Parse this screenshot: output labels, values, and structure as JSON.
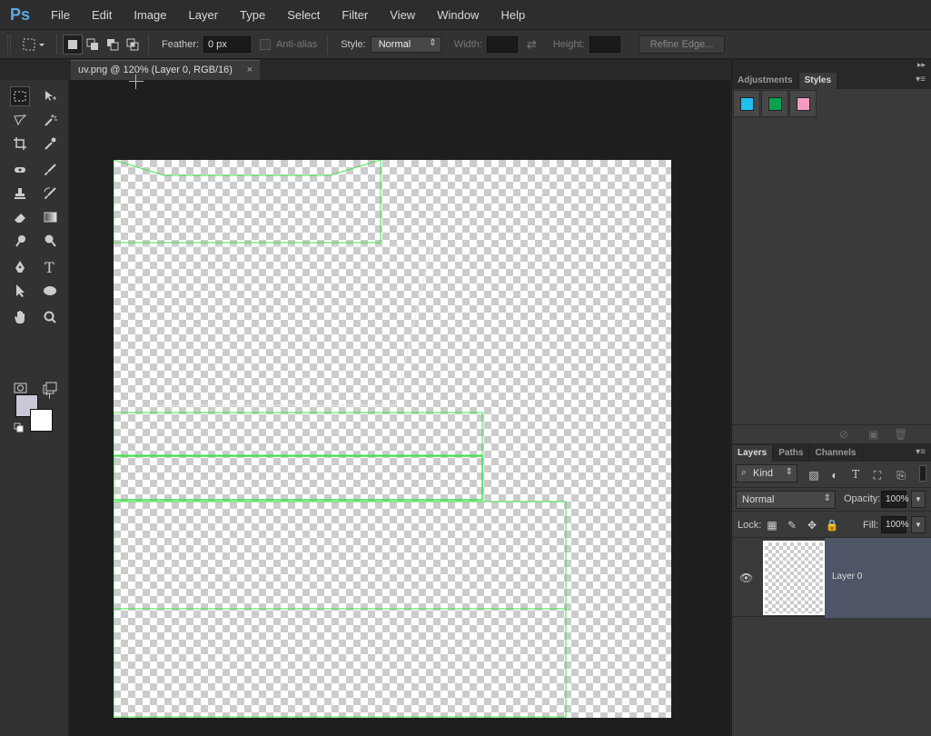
{
  "app": {
    "logo": "Ps"
  },
  "menu": [
    "File",
    "Edit",
    "Image",
    "Layer",
    "Type",
    "Select",
    "Filter",
    "View",
    "Window",
    "Help"
  ],
  "options": {
    "feather_label": "Feather:",
    "feather_value": "0 px",
    "antialias_label": "Anti-alias",
    "style_label": "Style:",
    "style_value": "Normal",
    "width_label": "Width:",
    "height_label": "Height:",
    "refine_edge": "Refine Edge..."
  },
  "document": {
    "tab_title": "uv.png @ 120% (Layer 0, RGB/16)",
    "close": "×"
  },
  "toolbox": {
    "collapse": "◂◂",
    "fg_color": "#c9c8d6",
    "bg_color": "#ffffff"
  },
  "panels": {
    "top_collapse": "▸▸",
    "adjust_tab": "Adjustments",
    "styles_tab": "Styles",
    "menu_glyph": "▾≡",
    "swatches": [
      "#1ec0f0",
      "#0aa14f",
      "#f49ac0"
    ],
    "layers_tab": "Layers",
    "paths_tab": "Paths",
    "channels_tab": "Channels"
  },
  "layers": {
    "kind_label": "Kind",
    "blend_mode": "Normal",
    "opacity_label": "Opacity:",
    "opacity_value": "100%",
    "lock_label": "Lock:",
    "fill_label": "Fill:",
    "fill_value": "100%",
    "layer_name": "Layer 0"
  },
  "uv_color": "#22ee33"
}
